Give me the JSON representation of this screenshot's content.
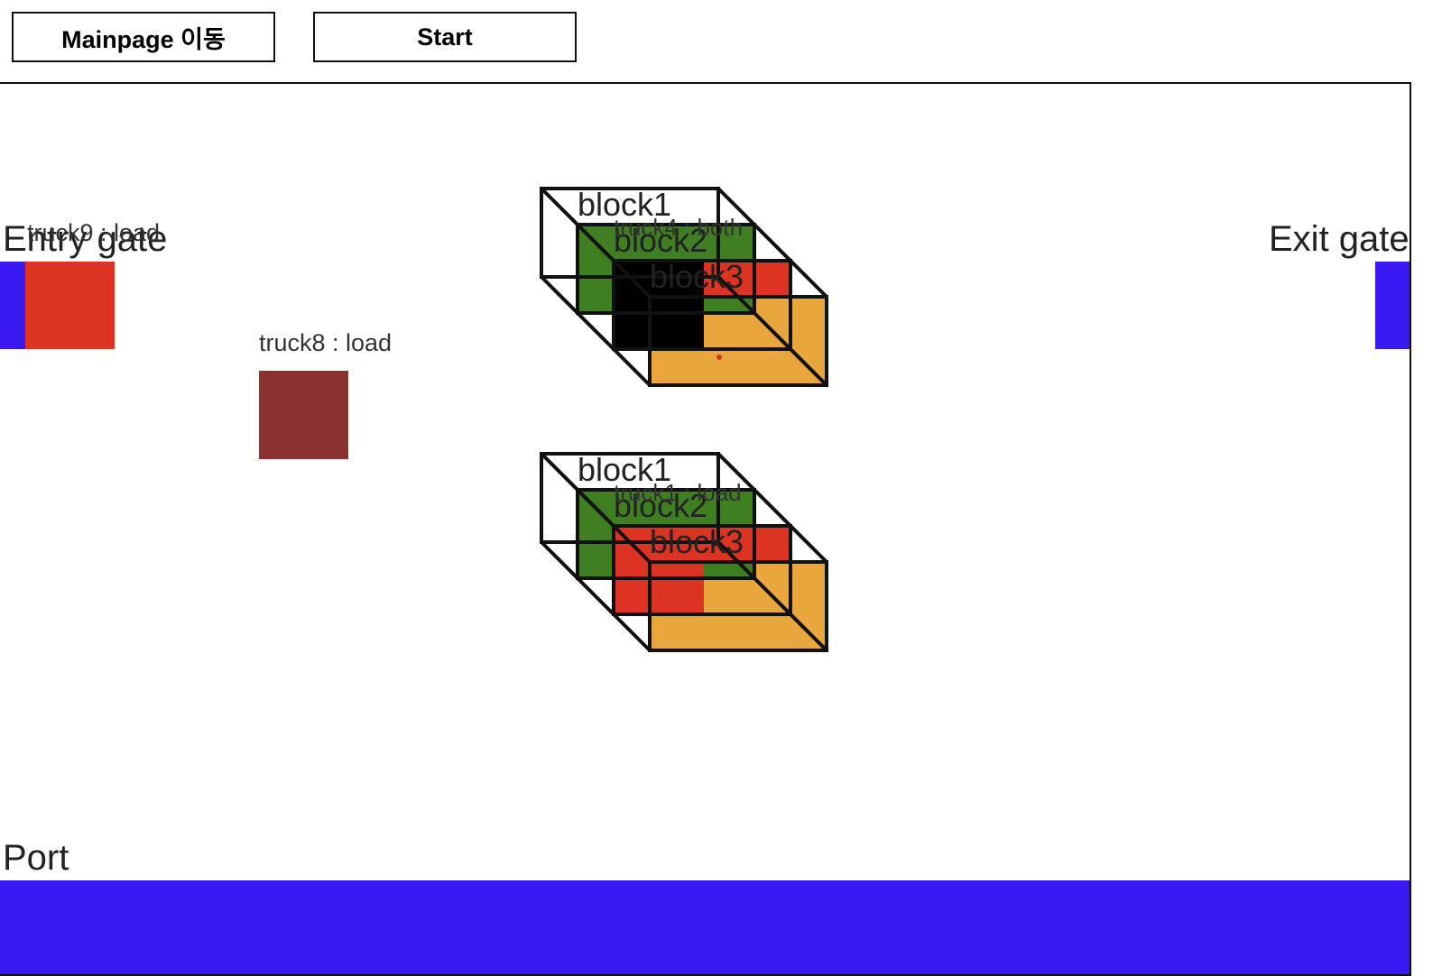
{
  "toolbar": {
    "mainpage_label": "Mainpage 이동",
    "start_label": "Start"
  },
  "scene": {
    "entry_gate_label": "Entry gate",
    "exit_gate_label": "Exit gate",
    "port_label": "Port",
    "trucks": [
      {
        "id": "truck9",
        "label": "truck9 : load",
        "color": "#dd3322"
      },
      {
        "id": "truck8",
        "label": "truck8 : load",
        "color": "#8b3131"
      }
    ],
    "blocks": [
      {
        "block1_label": "block1",
        "block2_label": "block2",
        "block3_label": "block3",
        "truck_label": "truck4 : both",
        "truck_color": "#000000"
      },
      {
        "block1_label": "block1",
        "block2_label": "block2",
        "block3_label": "block3",
        "truck_label": "truck1 : load",
        "truck_color": "#dd3322"
      }
    ],
    "colors": {
      "gate": "#3a1af2",
      "port": "#3a1af2",
      "block1": "#ffffff",
      "block2": "#3f7f22",
      "block3": "#dd3322",
      "block_base": "#e8a63c",
      "frame": "#111111"
    }
  }
}
